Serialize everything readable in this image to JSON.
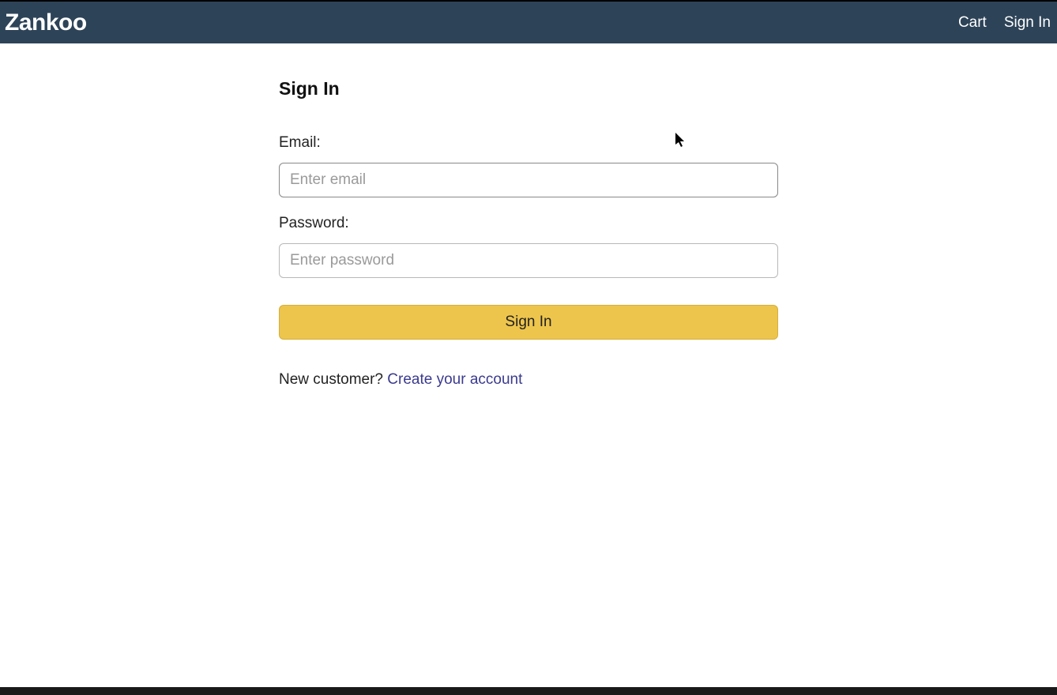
{
  "navbar": {
    "brand": "Zankoo",
    "links": {
      "cart": "Cart",
      "signin": "Sign In"
    }
  },
  "page": {
    "title": "Sign In"
  },
  "form": {
    "email_label": "Email:",
    "email_placeholder": "Enter email",
    "password_label": "Password:",
    "password_placeholder": "Enter password",
    "submit_label": "Sign In"
  },
  "signup": {
    "prompt": "New customer? ",
    "link_text": "Create your account"
  }
}
